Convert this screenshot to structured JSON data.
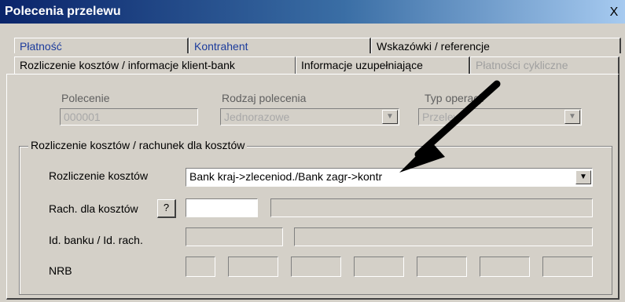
{
  "window": {
    "title": "Polecenia przelewu",
    "close_glyph": "X"
  },
  "tabs_row1": [
    "Płatność",
    "Kontrahent",
    "Wskazówki / referencje"
  ],
  "tabs_row2": [
    "Rozliczenie kosztów / informacje klient-bank",
    "Informacje uzupełniające",
    "Płatności cykliczne"
  ],
  "form": {
    "polecenie_label": "Polecenie",
    "polecenie_value": "000001",
    "rodzaj_label": "Rodzaj polecenia",
    "rodzaj_value": "Jednorazowe",
    "typ_label": "Typ operacji",
    "typ_value": "Przelew"
  },
  "group": {
    "legend": "Rozliczenie kosztów / rachunek dla kosztów",
    "rozliczenie_label": "Rozliczenie kosztów",
    "rozliczenie_value": "Bank kraj->zleceniod./Bank zagr->kontr",
    "rach_label": "Rach. dla kosztów",
    "help_button": "?",
    "idbank_label": "Id. banku / Id. rach.",
    "nrb_label": "NRB"
  },
  "colors": {
    "arrow": "#000000",
    "tab_blue_text": "#1b3b9c"
  }
}
